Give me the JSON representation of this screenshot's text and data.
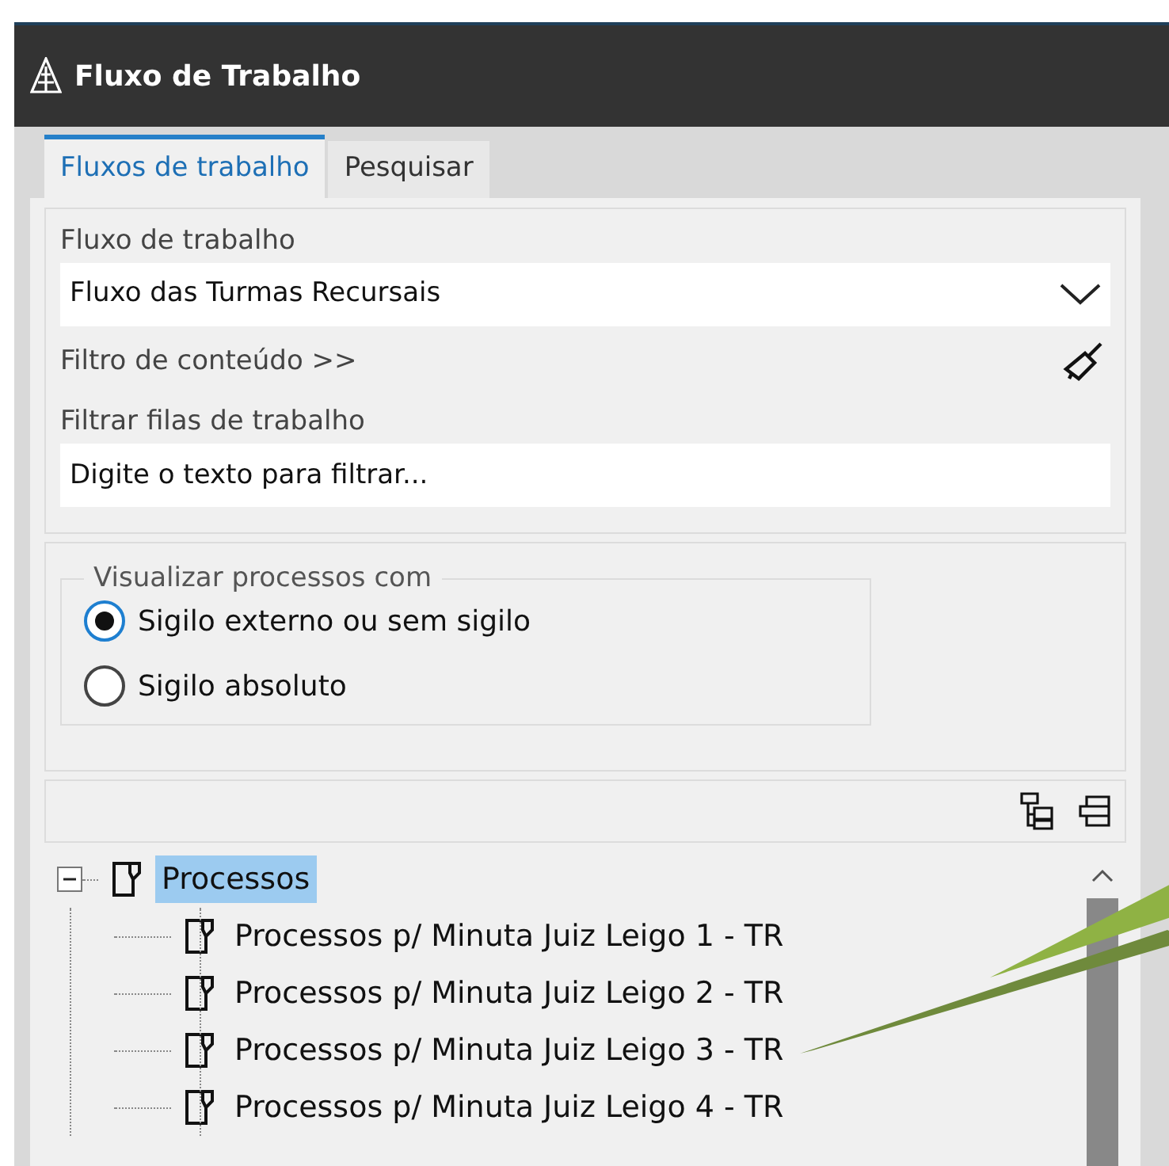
{
  "window": {
    "title": "Fluxo de Trabalho"
  },
  "tabs": [
    {
      "label": "Fluxos de trabalho",
      "selected": true
    },
    {
      "label": "Pesquisar",
      "selected": false
    }
  ],
  "workflow": {
    "label": "Fluxo de trabalho",
    "value": "Fluxo das Turmas Recursais"
  },
  "content_filter": {
    "label": "Filtro de conteúdo >>"
  },
  "queue_filter": {
    "label": "Filtrar filas de trabalho",
    "placeholder": "Digite o texto para filtrar..."
  },
  "visibility": {
    "legend": "Visualizar processos com",
    "options": [
      {
        "label": "Sigilo externo ou sem sigilo",
        "selected": true
      },
      {
        "label": "Sigilo absoluto",
        "selected": false
      }
    ]
  },
  "tree": [
    {
      "label": "Processos",
      "selected": true,
      "expanded": true,
      "children": [
        {
          "label": "Processos p/ Minuta Juiz Leigo 1 - TR",
          "selected": false
        },
        {
          "label": "Processos p/ Minuta Juiz Leigo 2 - TR",
          "selected": false
        },
        {
          "label": "Processos p/ Minuta Juiz Leigo 3 - TR",
          "selected": false
        },
        {
          "label": "Processos p/ Minuta Juiz Leigo 4 - TR",
          "selected": false
        }
      ]
    }
  ]
}
